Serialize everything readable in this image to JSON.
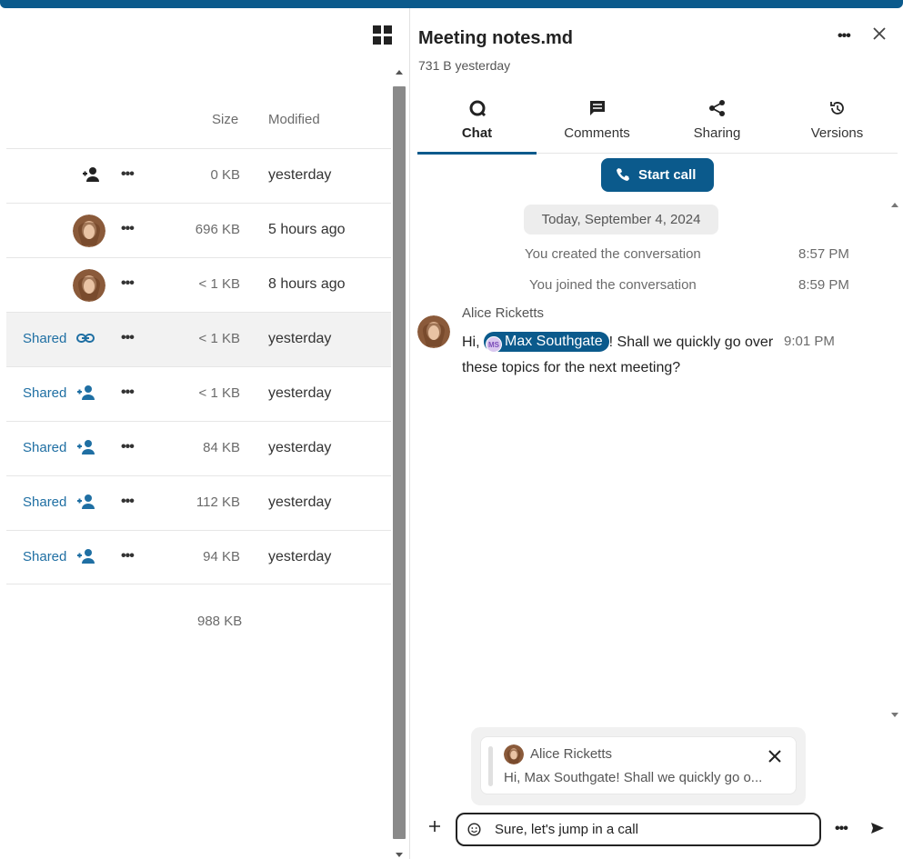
{
  "file_list": {
    "columns": {
      "size": "Size",
      "modified": "Modified"
    },
    "rows": [
      {
        "share_label": "",
        "share_icon": "add-share-icon",
        "avatar": false,
        "size": "0 KB",
        "modified": "yesterday"
      },
      {
        "share_label": "",
        "share_icon": "",
        "avatar": true,
        "size": "696 KB",
        "modified": "5 hours ago"
      },
      {
        "share_label": "",
        "share_icon": "",
        "avatar": true,
        "size": "< 1 KB",
        "modified": "8 hours ago"
      },
      {
        "share_label": "Shared",
        "share_icon": "link-icon",
        "avatar": false,
        "size": "< 1 KB",
        "modified": "yesterday"
      },
      {
        "share_label": "Shared",
        "share_icon": "add-share-icon",
        "avatar": false,
        "size": "< 1 KB",
        "modified": "yesterday"
      },
      {
        "share_label": "Shared",
        "share_icon": "add-share-icon",
        "avatar": false,
        "size": "84 KB",
        "modified": "yesterday"
      },
      {
        "share_label": "Shared",
        "share_icon": "add-share-icon",
        "avatar": false,
        "size": "112 KB",
        "modified": "yesterday"
      },
      {
        "share_label": "Shared",
        "share_icon": "add-share-icon",
        "avatar": false,
        "size": "94 KB",
        "modified": "yesterday"
      }
    ],
    "total_size": "988 KB"
  },
  "sidebar": {
    "title": "Meeting notes.md",
    "subtitle": "731 B yesterday",
    "tabs": [
      {
        "label": "Chat",
        "icon": "chat-icon",
        "active": true
      },
      {
        "label": "Comments",
        "icon": "comment-icon",
        "active": false
      },
      {
        "label": "Sharing",
        "icon": "share-icon",
        "active": false
      },
      {
        "label": "Versions",
        "icon": "history-icon",
        "active": false
      }
    ],
    "start_call_label": "Start call",
    "date_separator": "Today, September 4, 2024",
    "system_messages": [
      {
        "text": "You created the conversation",
        "time": "8:57 PM"
      },
      {
        "text": "You joined the conversation",
        "time": "8:59 PM"
      }
    ],
    "message": {
      "author": "Alice Ricketts",
      "text_before": "Hi, ",
      "mention": "Max Southgate",
      "mention_initials": "MS",
      "text_after": "! Shall we quickly go over these topics for the next meeting?",
      "time": "9:01 PM"
    },
    "reply_preview": {
      "author": "Alice Ricketts",
      "text": "Hi, Max Southgate! Shall we quickly go o..."
    },
    "composer": {
      "value": "Sure, let's jump in a call"
    }
  },
  "colors": {
    "accent": "#0b5a8c",
    "link": "#1f6fa3"
  }
}
